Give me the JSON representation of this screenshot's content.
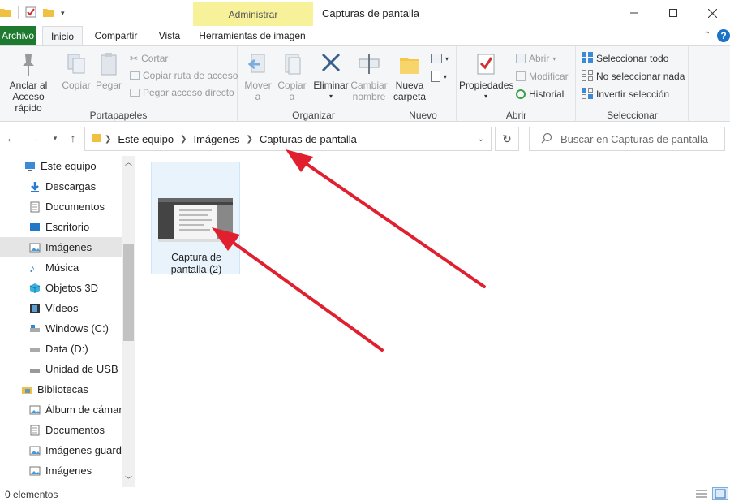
{
  "window": {
    "title": "Capturas de pantalla",
    "context_tab": "Administrar"
  },
  "tabs": [
    {
      "label": "Archivo"
    },
    {
      "label": "Inicio"
    },
    {
      "label": "Compartir"
    },
    {
      "label": "Vista"
    },
    {
      "label": "Herramientas de imagen"
    }
  ],
  "help_label": "?",
  "ribbon": {
    "portapapeles": {
      "label": "Portapapeles",
      "anclar_line1": "Anclar al",
      "anclar_line2": "Acceso rápido",
      "copiar": "Copiar",
      "pegar": "Pegar",
      "cortar": "Cortar",
      "copiar_ruta": "Copiar ruta de acceso",
      "pegar_acceso": "Pegar acceso directo"
    },
    "organizar": {
      "label": "Organizar",
      "mover_line1": "Mover",
      "mover_line2": "a",
      "copiar_line1": "Copiar",
      "copiar_line2": "a",
      "eliminar": "Eliminar",
      "cambiar_line1": "Cambiar",
      "cambiar_line2": "nombre"
    },
    "nuevo": {
      "label": "Nuevo",
      "nueva_line1": "Nueva",
      "nueva_line2": "carpeta"
    },
    "abrir": {
      "label": "Abrir",
      "propiedades": "Propiedades",
      "abrir": "Abrir",
      "modificar": "Modificar",
      "historial": "Historial"
    },
    "seleccionar": {
      "label": "Seleccionar",
      "todo": "Seleccionar todo",
      "nada": "No seleccionar nada",
      "invertir": "Invertir selección"
    }
  },
  "address": {
    "crumbs": [
      "Este equipo",
      "Imágenes",
      "Capturas de pantalla"
    ]
  },
  "search": {
    "placeholder": "Buscar en Capturas de pantalla"
  },
  "navpane": {
    "items": [
      {
        "label": "Este equipo",
        "icon": "computer-icon"
      },
      {
        "label": "Descargas",
        "icon": "download-icon"
      },
      {
        "label": "Documentos",
        "icon": "document-icon"
      },
      {
        "label": "Escritorio",
        "icon": "desktop-icon"
      },
      {
        "label": "Imágenes",
        "icon": "pictures-icon"
      },
      {
        "label": "Música",
        "icon": "music-icon"
      },
      {
        "label": "Objetos 3D",
        "icon": "cube-icon"
      },
      {
        "label": "Vídeos",
        "icon": "video-icon"
      },
      {
        "label": "Windows (C:)",
        "icon": "drive-icon"
      },
      {
        "label": "Data (D:)",
        "icon": "drive-icon"
      },
      {
        "label": "Unidad de USB (E",
        "icon": "usb-drive-icon"
      },
      {
        "label": "Bibliotecas",
        "icon": "library-icon"
      },
      {
        "label": "Álbum de cámara",
        "icon": "pictures-icon"
      },
      {
        "label": "Documentos",
        "icon": "document-icon"
      },
      {
        "label": "Imágenes guarda",
        "icon": "pictures-icon"
      },
      {
        "label": "Imágenes",
        "icon": "pictures-icon"
      }
    ]
  },
  "content": {
    "file": {
      "name_line1": "Captura de",
      "name_line2": "pantalla (2)"
    }
  },
  "status": {
    "count": "0 elementos"
  },
  "colors": {
    "file_tab": "#1e7a2e",
    "context_tab": "#f7f29a",
    "arrow": "#e0202e",
    "selection": "#e9f3fc"
  }
}
